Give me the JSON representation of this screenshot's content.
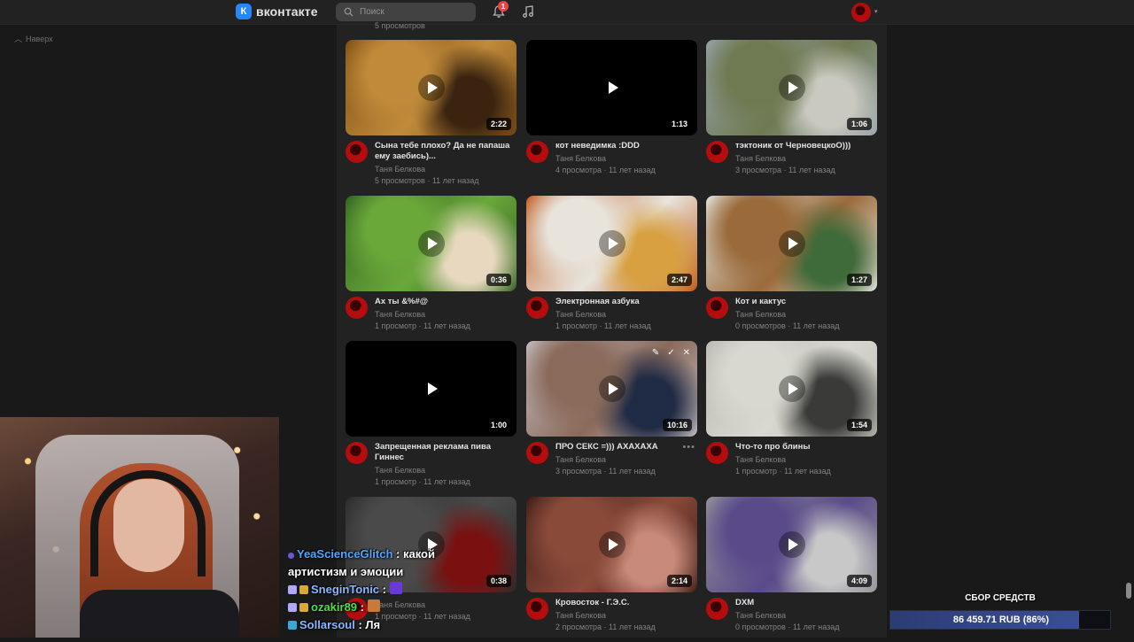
{
  "header": {
    "logo_text": "вконтакте",
    "search_placeholder": "Поиск",
    "notification_count": "1"
  },
  "back_to_top_label": "Наверх",
  "partial_row_stats": "5 просмотров",
  "videos": [
    {
      "title": "Сына тебе плохо? Да не папаша ему заебись)...",
      "duration": "2:22",
      "owner": "Таня Белкова",
      "views": "5 просмотров",
      "age": "11 лет назад",
      "thumb_colors": [
        "#7a4a12",
        "#c08a3a",
        "#3a2410"
      ]
    },
    {
      "title": "кот неведимка :DDD",
      "duration": "1:13",
      "owner": "Таня Белкова",
      "views": "4 просмотра",
      "age": "11 лет назад",
      "thumb_colors": [
        "#000000",
        "#000000",
        "#000000"
      ]
    },
    {
      "title": "тэктоник от ЧерновецкоО)))",
      "duration": "1:06",
      "owner": "Таня Белкова",
      "views": "3 просмотра",
      "age": "11 лет назад",
      "thumb_colors": [
        "#9aa6b2",
        "#6f7a52",
        "#c9c9c0"
      ]
    },
    {
      "title": "Ах ты &%#@",
      "duration": "0:36",
      "owner": "Таня Белкова",
      "views": "1 просмотр",
      "age": "11 лет назад",
      "thumb_colors": [
        "#2f5d1f",
        "#6aa83a",
        "#e8d8c0"
      ]
    },
    {
      "title": "Электронная азбука",
      "duration": "2:47",
      "owner": "Таня Белкова",
      "views": "1 просмотр",
      "age": "11 лет назад",
      "thumb_colors": [
        "#c0561a",
        "#e8e4dc",
        "#d8a040"
      ]
    },
    {
      "title": "Кот и кактус",
      "duration": "1:27",
      "owner": "Таня Белкова",
      "views": "0 просмотров",
      "age": "11 лет назад",
      "thumb_colors": [
        "#e8ece8",
        "#9a6a3a",
        "#3f6a3a"
      ]
    },
    {
      "title": "Запрещенная реклама пива Гиннес",
      "duration": "1:00",
      "owner": "Таня Белкова",
      "views": "1 просмотр",
      "age": "11 лет назад",
      "thumb_colors": [
        "#000000",
        "#000000",
        "#000000"
      ]
    },
    {
      "title": "ПРО СЕКС =))) АХАХАХА",
      "duration": "10:16",
      "owner": "Таня Белкова",
      "views": "3 просмотра",
      "age": "11 лет назад",
      "thumb_colors": [
        "#c8c2c8",
        "#8a6a5a",
        "#1f2a45"
      ]
    },
    {
      "title": "Что-то про блины",
      "duration": "1:54",
      "owner": "Таня Белкова",
      "views": "1 просмотр",
      "age": "11 лет назад",
      "thumb_colors": [
        "#b8b8b0",
        "#d8d8d0",
        "#3a3a38"
      ]
    },
    {
      "title": "",
      "duration": "0:38",
      "owner": "Таня Белкова",
      "views": "1 просмотр",
      "age": "11 лет назад",
      "thumb_colors": [
        "#2a2a2a",
        "#4a4a4a",
        "#7a1010"
      ]
    },
    {
      "title": "Кровосток - Г.Э.С.",
      "duration": "2:14",
      "owner": "Таня Белкова",
      "views": "2 просмотра",
      "age": "11 лет назад",
      "thumb_colors": [
        "#3a1a14",
        "#8a4a3a",
        "#c88a7a"
      ]
    },
    {
      "title": "DXM",
      "duration": "4:09",
      "owner": "Таня Белкова",
      "views": "0 просмотров",
      "age": "11 лет назад",
      "thumb_colors": [
        "#9a9a9a",
        "#5a4a8a",
        "#c8c8c8"
      ]
    }
  ],
  "chat": [
    {
      "user": "YeaScienceGlitch",
      "message": "какой",
      "continuation": "артистизм и эмоции",
      "color": "#4ea6ff"
    },
    {
      "user": "SneginTonic",
      "message": "",
      "color": "#8ab6ff"
    },
    {
      "user": "ozakir89",
      "message": "",
      "color": "#48e048"
    },
    {
      "user": "Sollarsoul",
      "message": "Ля",
      "color": "#8ab6ff"
    }
  ],
  "donation": {
    "title": "СБОР СРЕДСТВ",
    "amount_text": "86 459.71 RUB (86%)",
    "progress_fraction": 0.86
  }
}
